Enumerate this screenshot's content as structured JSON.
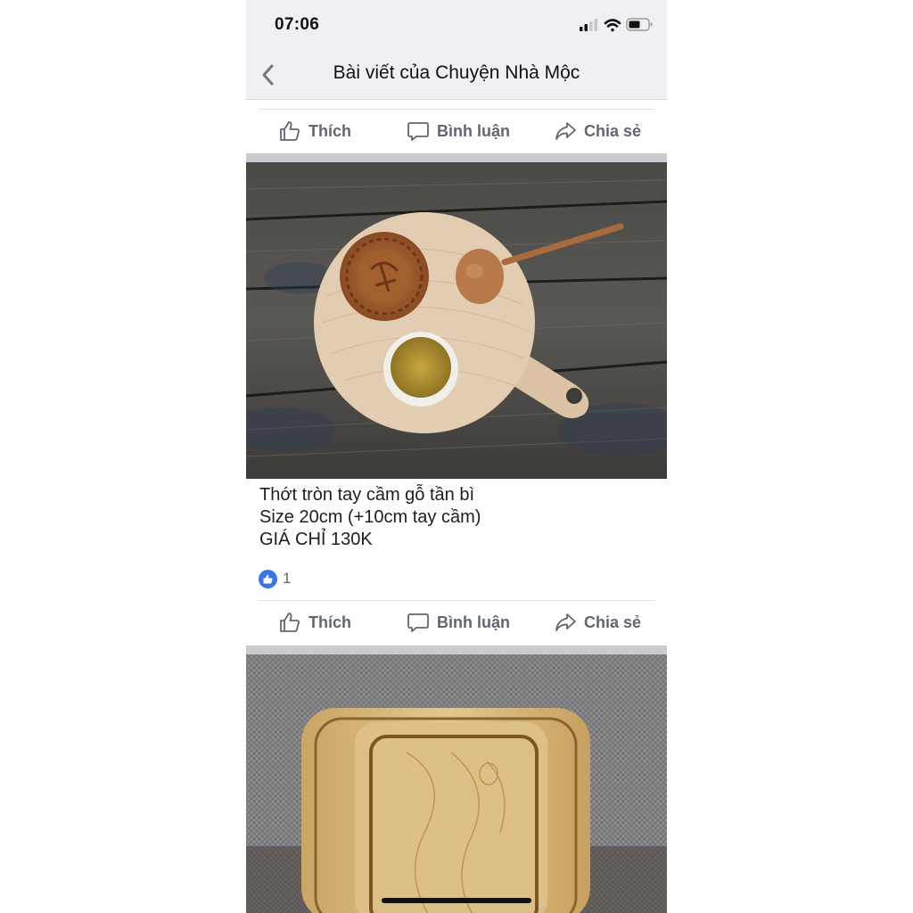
{
  "status": {
    "time": "07:06"
  },
  "nav": {
    "title": "Bài viết của Chuyện Nhà Mộc",
    "back_icon": "chevron-left-icon"
  },
  "actions": {
    "like_label": "Thích",
    "comment_label": "Bình luận",
    "share_label": "Chia sẻ"
  },
  "post": {
    "caption_lines": [
      "Thớt tròn tay cầm gỗ tần bì",
      "Size 20cm (+10cm tay cầm)",
      "GIÁ CHỈ 130K"
    ],
    "like_count": "1"
  },
  "colors": {
    "accent": "#3b74e6",
    "action_text": "#606770",
    "bar_bg": "#f0eff3"
  }
}
